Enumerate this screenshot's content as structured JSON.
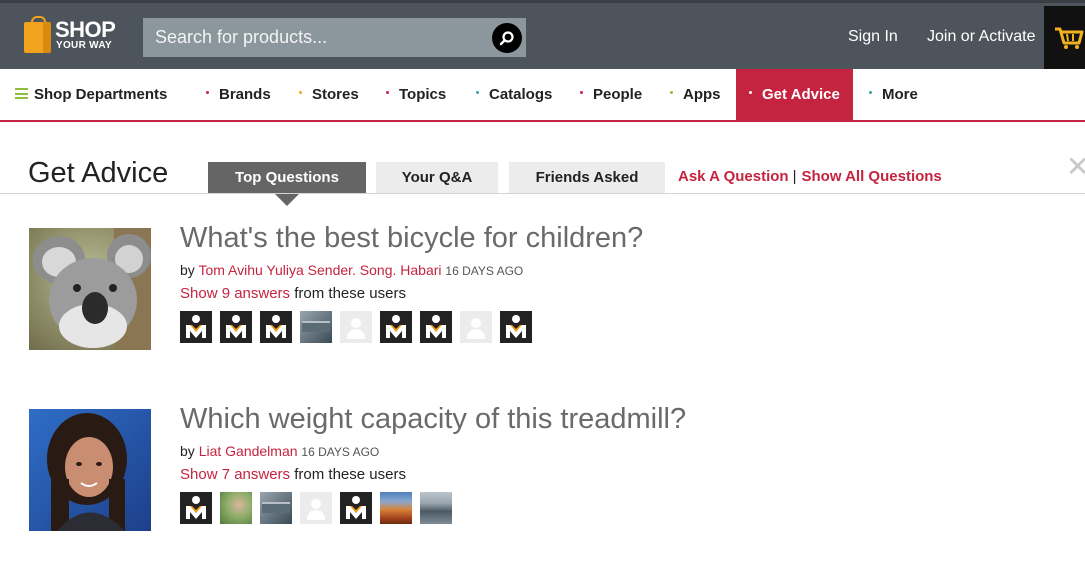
{
  "header": {
    "logo_shop": "SHOP",
    "logo_yourway": "YOUR WAY",
    "search_placeholder": "Search for products...",
    "sign_in": "Sign In",
    "join": "Join or Activate",
    "colors": {
      "bar": "#4e545c",
      "accent": "#c4243f",
      "logo_bag": "#f2a21f",
      "cart_icon": "#f2b21f"
    }
  },
  "nav": {
    "departments": "Shop Departments",
    "items": [
      {
        "label": "Brands",
        "dot": "#c4243f"
      },
      {
        "label": "Stores",
        "dot": "#f2a21f"
      },
      {
        "label": "Topics",
        "dot": "#c4243f"
      },
      {
        "label": "Catalogs",
        "dot": "#3aa3a3"
      },
      {
        "label": "People",
        "dot": "#c4243f"
      },
      {
        "label": "Apps",
        "dot": "#8fbf3a"
      },
      {
        "label": "Get Advice",
        "dot": "#ffffff",
        "active": true
      },
      {
        "label": "More",
        "dot": "#3aa3a3"
      }
    ]
  },
  "advice": {
    "title": "Get Advice",
    "tabs": [
      {
        "label": "Top Questions",
        "active": true
      },
      {
        "label": "Your Q&A",
        "active": false
      },
      {
        "label": "Friends Asked",
        "active": false
      }
    ],
    "ask_question": "Ask A Question",
    "separator": "|",
    "show_all": "Show All Questions",
    "close": "✕"
  },
  "questions": [
    {
      "title": "What's the best bicycle for children?",
      "by": "by",
      "author": "Tom Avihu Yuliya Sender. Song. Habari",
      "ago": "16 DAYS AGO",
      "show_link": "Show 9 answers",
      "show_suffix": "from these users",
      "avatars": [
        "m",
        "m",
        "m",
        "photo",
        "blank",
        "m",
        "m",
        "blank",
        "m"
      ]
    },
    {
      "title": "Which weight capacity of this treadmill?",
      "by": "by",
      "author": "Liat Gandelman",
      "ago": "16 DAYS AGO",
      "show_link": "Show 7 answers",
      "show_suffix": "from these users",
      "avatars": [
        "m",
        "green",
        "photo",
        "blank",
        "m",
        "canyon",
        "building"
      ]
    }
  ]
}
